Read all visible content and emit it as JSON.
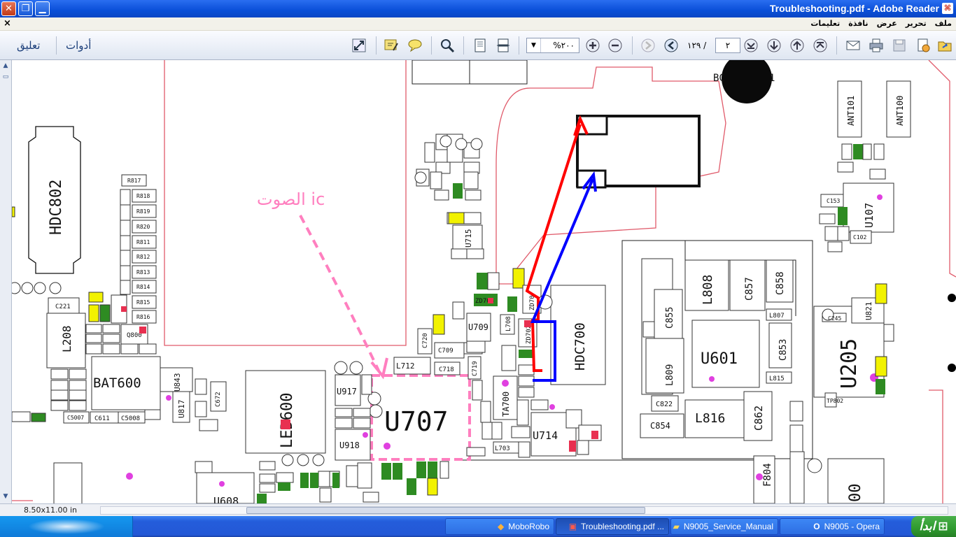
{
  "window": {
    "title": "Troubleshooting.pdf - Adobe Reader",
    "app_icon": "pdf-icon"
  },
  "menu": {
    "close_doc": "×",
    "items": [
      "ملف",
      "تحرير",
      "عرض",
      "نافذة",
      "تعليمات"
    ]
  },
  "toolbar": {
    "comment_label": "تعليق",
    "tools_label": "أدوات",
    "zoom_value": "%٢٠٠",
    "page_current": "٢",
    "page_total": "١٢٩ /",
    "icons": [
      "fit-page-icon",
      "highlight-icon",
      "comment-bubble-icon",
      "search-icon",
      "page-fit-icon",
      "print-page-icon",
      "zoom-in-icon",
      "zoom-out-icon",
      "prev-view-icon",
      "next-view-icon",
      "last-page-icon",
      "next-page-icon",
      "prev-page-icon",
      "first-page-icon",
      "email-icon",
      "print-icon",
      "save-icon",
      "sign-icon",
      "open-icon"
    ]
  },
  "document": {
    "annotation_text": "الصوت ic",
    "components": {
      "hdc802": "HDC802",
      "hdc700": "HDC700",
      "bat600": "BAT600",
      "led600": "LED600",
      "u707": "U707",
      "u205": "U205",
      "u601": "U601",
      "u107": "U107",
      "u714": "U714",
      "u709": "U709",
      "u917": "U917",
      "u918": "U918",
      "u817": "U817",
      "u843": "U843",
      "u715": "U715",
      "u608": "U608",
      "u821": "U821",
      "ant101": "ANT101",
      "ant100": "ANT100",
      "l208": "L208",
      "l712": "L712",
      "l808": "L808",
      "l816": "L816",
      "l809": "L809",
      "l703": "L703",
      "l708": "L708",
      "c857": "C857",
      "c858": "C858",
      "c855": "C855",
      "c853": "C853",
      "c862": "C862",
      "c854": "C854",
      "c822": "C822",
      "c221": "C221",
      "c709": "C709",
      "c718": "C718",
      "c720": "C720",
      "c719": "C719",
      "c672": "C672",
      "c611": "C611",
      "c5008": "C5008",
      "c5007": "C5007",
      "c153": "C153",
      "c102": "C102",
      "f804": "F804",
      "ta700": "TA700",
      "zd705": "ZD705",
      "zd702": "ZD702",
      "zd70x": "ZD70",
      "q800": "Q800",
      "tp802": "TP802",
      "l807": "L807",
      "l815": "L815",
      "c245": "C245",
      "bc": "BC",
      "b1": "1",
      "resistors_left": [
        "R817",
        "R818",
        "R819",
        "R820",
        "R811",
        "R812",
        "R813",
        "R814",
        "R815",
        "R816"
      ]
    }
  },
  "status": {
    "page_size": "8.50x11.00 in"
  },
  "taskbar": {
    "start_label": "ابدأ",
    "tasks": [
      {
        "label": "N9005 - Opera",
        "icon": "opera-icon"
      },
      {
        "label": "N9005_Service_Manual",
        "icon": "folder-icon"
      },
      {
        "label": "Troubleshooting.pdf ...",
        "icon": "pdf-icon"
      },
      {
        "label": "MoboRobo",
        "icon": "moborobo-icon"
      }
    ]
  },
  "colors": {
    "titlebar": "#0a4fd8",
    "trace_red": "#ff0000",
    "trace_blue": "#0000ff",
    "annotation_pink": "#ff7fbf",
    "board_outline": "#e05a6a",
    "comp_green": "#2e8b22",
    "comp_yellow": "#f2f200"
  }
}
